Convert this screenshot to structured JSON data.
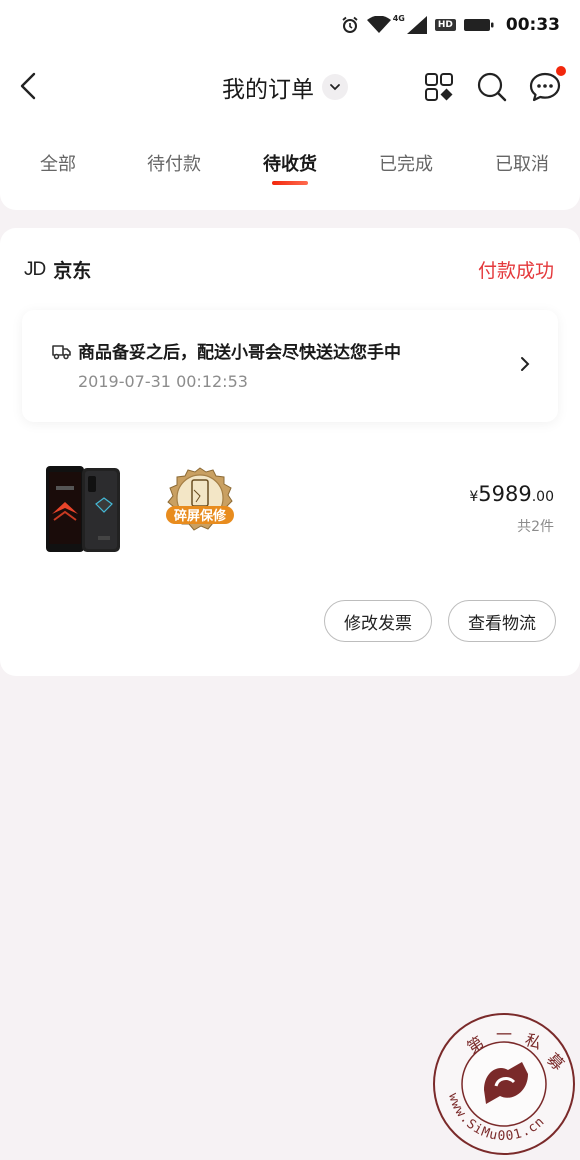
{
  "status_bar": {
    "network": "4G",
    "hd": "HD",
    "time": "00:33"
  },
  "header": {
    "title": "我的订单"
  },
  "tabs": [
    {
      "label": "全部",
      "active": false
    },
    {
      "label": "待付款",
      "active": false
    },
    {
      "label": "待收货",
      "active": true
    },
    {
      "label": "已完成",
      "active": false
    },
    {
      "label": "已取消",
      "active": false
    }
  ],
  "order": {
    "shop_logo": "JD",
    "shop_name": "京东",
    "status": "付款成功",
    "delivery": {
      "message": "商品备妥之后，配送小哥会尽快送达您手中",
      "time": "2019-07-31 00:12:53"
    },
    "warranty_label": "碎屏保修",
    "price": {
      "currency": "¥",
      "integer": "5989",
      "decimal": ".00"
    },
    "quantity_text": "共2件",
    "buttons": {
      "invoice": "修改发票",
      "logistics": "查看物流"
    }
  },
  "watermark": {
    "title": "第一私募",
    "url": "www.SiMu001.cn"
  },
  "colors": {
    "accent_red": "#e4393c",
    "badge_red": "#f2270c",
    "page_bg": "#f6f2f4"
  }
}
